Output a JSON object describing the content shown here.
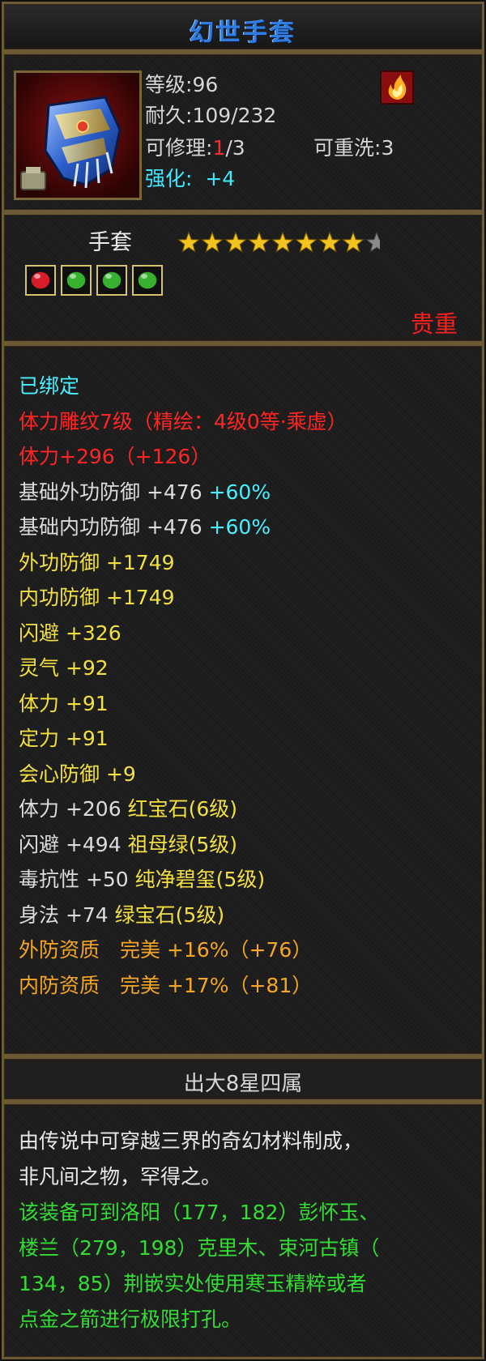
{
  "title": "幻世手套",
  "info": {
    "level_label": "等级",
    "level_value": "96",
    "durability_label": "耐久",
    "durability_value": "109/232",
    "repair_label": "可修理",
    "repair_current": "1",
    "repair_total": "/3",
    "rewash_label": "可重洗",
    "rewash_value": "3",
    "enhance_label": "强化",
    "enhance_value": "+4",
    "item_icon": "blue-gauntlet-icon",
    "element_icon": "fire-element-icon"
  },
  "type_section": {
    "type_label": "手套",
    "stars_filled": 8,
    "stars_total": 9,
    "gems": [
      "red-gem-icon",
      "green-gem-icon",
      "green-gem-icon",
      "green-gem-icon"
    ],
    "rarity": "贵重"
  },
  "attributes": [
    {
      "text": "已绑定",
      "color": "#46f0ff"
    },
    {
      "text": "体力雕纹7级（精绘：4级0等·乘虚）",
      "color": "#ff2525"
    },
    {
      "text": "体力+296（+126）",
      "color": "#ff2525"
    },
    {
      "text": "基础外功防御 +476",
      "extra": "+60%",
      "color": "#dcdcdc"
    },
    {
      "text": "基础内功防御 +476",
      "extra": "+60%",
      "color": "#dcdcdc"
    },
    {
      "text": "外功防御 +1749",
      "color": "#f2e040"
    },
    {
      "text": "内功防御 +1749",
      "color": "#f2e040"
    },
    {
      "text": "闪避 +326",
      "color": "#f2e040"
    },
    {
      "text": "灵气 +92",
      "color": "#f2e040"
    },
    {
      "text": "体力 +91",
      "color": "#f2e040"
    },
    {
      "text": "定力 +91",
      "color": "#f2e040"
    },
    {
      "text": "会心防御 +9",
      "color": "#f2e040"
    },
    {
      "text": "体力 +206",
      "gem": "红宝石(6级)",
      "color": "#dcdcdc"
    },
    {
      "text": "闪避 +494",
      "gem": "祖母绿(5级)",
      "color": "#dcdcdc"
    },
    {
      "text": "毒抗性 +50",
      "gem": "纯净碧玺(5级)",
      "color": "#dcdcdc"
    },
    {
      "text": "身法 +74",
      "gem": "绿宝石(5级)",
      "color": "#dcdcdc"
    },
    {
      "text": "外防资质　完美 +16%（+76）",
      "color": "#f5a623"
    },
    {
      "text": "内防资质　完美 +17%（+81）",
      "color": "#f5a623"
    }
  ],
  "tag": "出大8星四属",
  "description": [
    {
      "text": "由传说中可穿越三界的奇幻材料制成，",
      "color": "#e8e8e8"
    },
    {
      "text": "非凡间之物，罕得之。",
      "color": "#e8e8e8"
    },
    {
      "text": "该装备可到洛阳（177，182）彭怀玉、",
      "color": "#33dd33"
    },
    {
      "text": "楼兰（279，198）克里木、束河古镇（",
      "color": "#33dd33"
    },
    {
      "text": "134，85）荆嵌实处使用寒玉精粹或者",
      "color": "#33dd33"
    },
    {
      "text": "点金之箭进行极限打孔。",
      "color": "#33dd33"
    }
  ],
  "colors": {
    "border": "#6b5a34",
    "title_blue": "#2f7de0",
    "yellow": "#f2e040",
    "orange": "#f5a623",
    "cyan": "#46f0ff",
    "red": "#ff2525",
    "green": "#33dd33",
    "star_gold": "#f3c320",
    "star_gray": "#8a8a8a"
  }
}
